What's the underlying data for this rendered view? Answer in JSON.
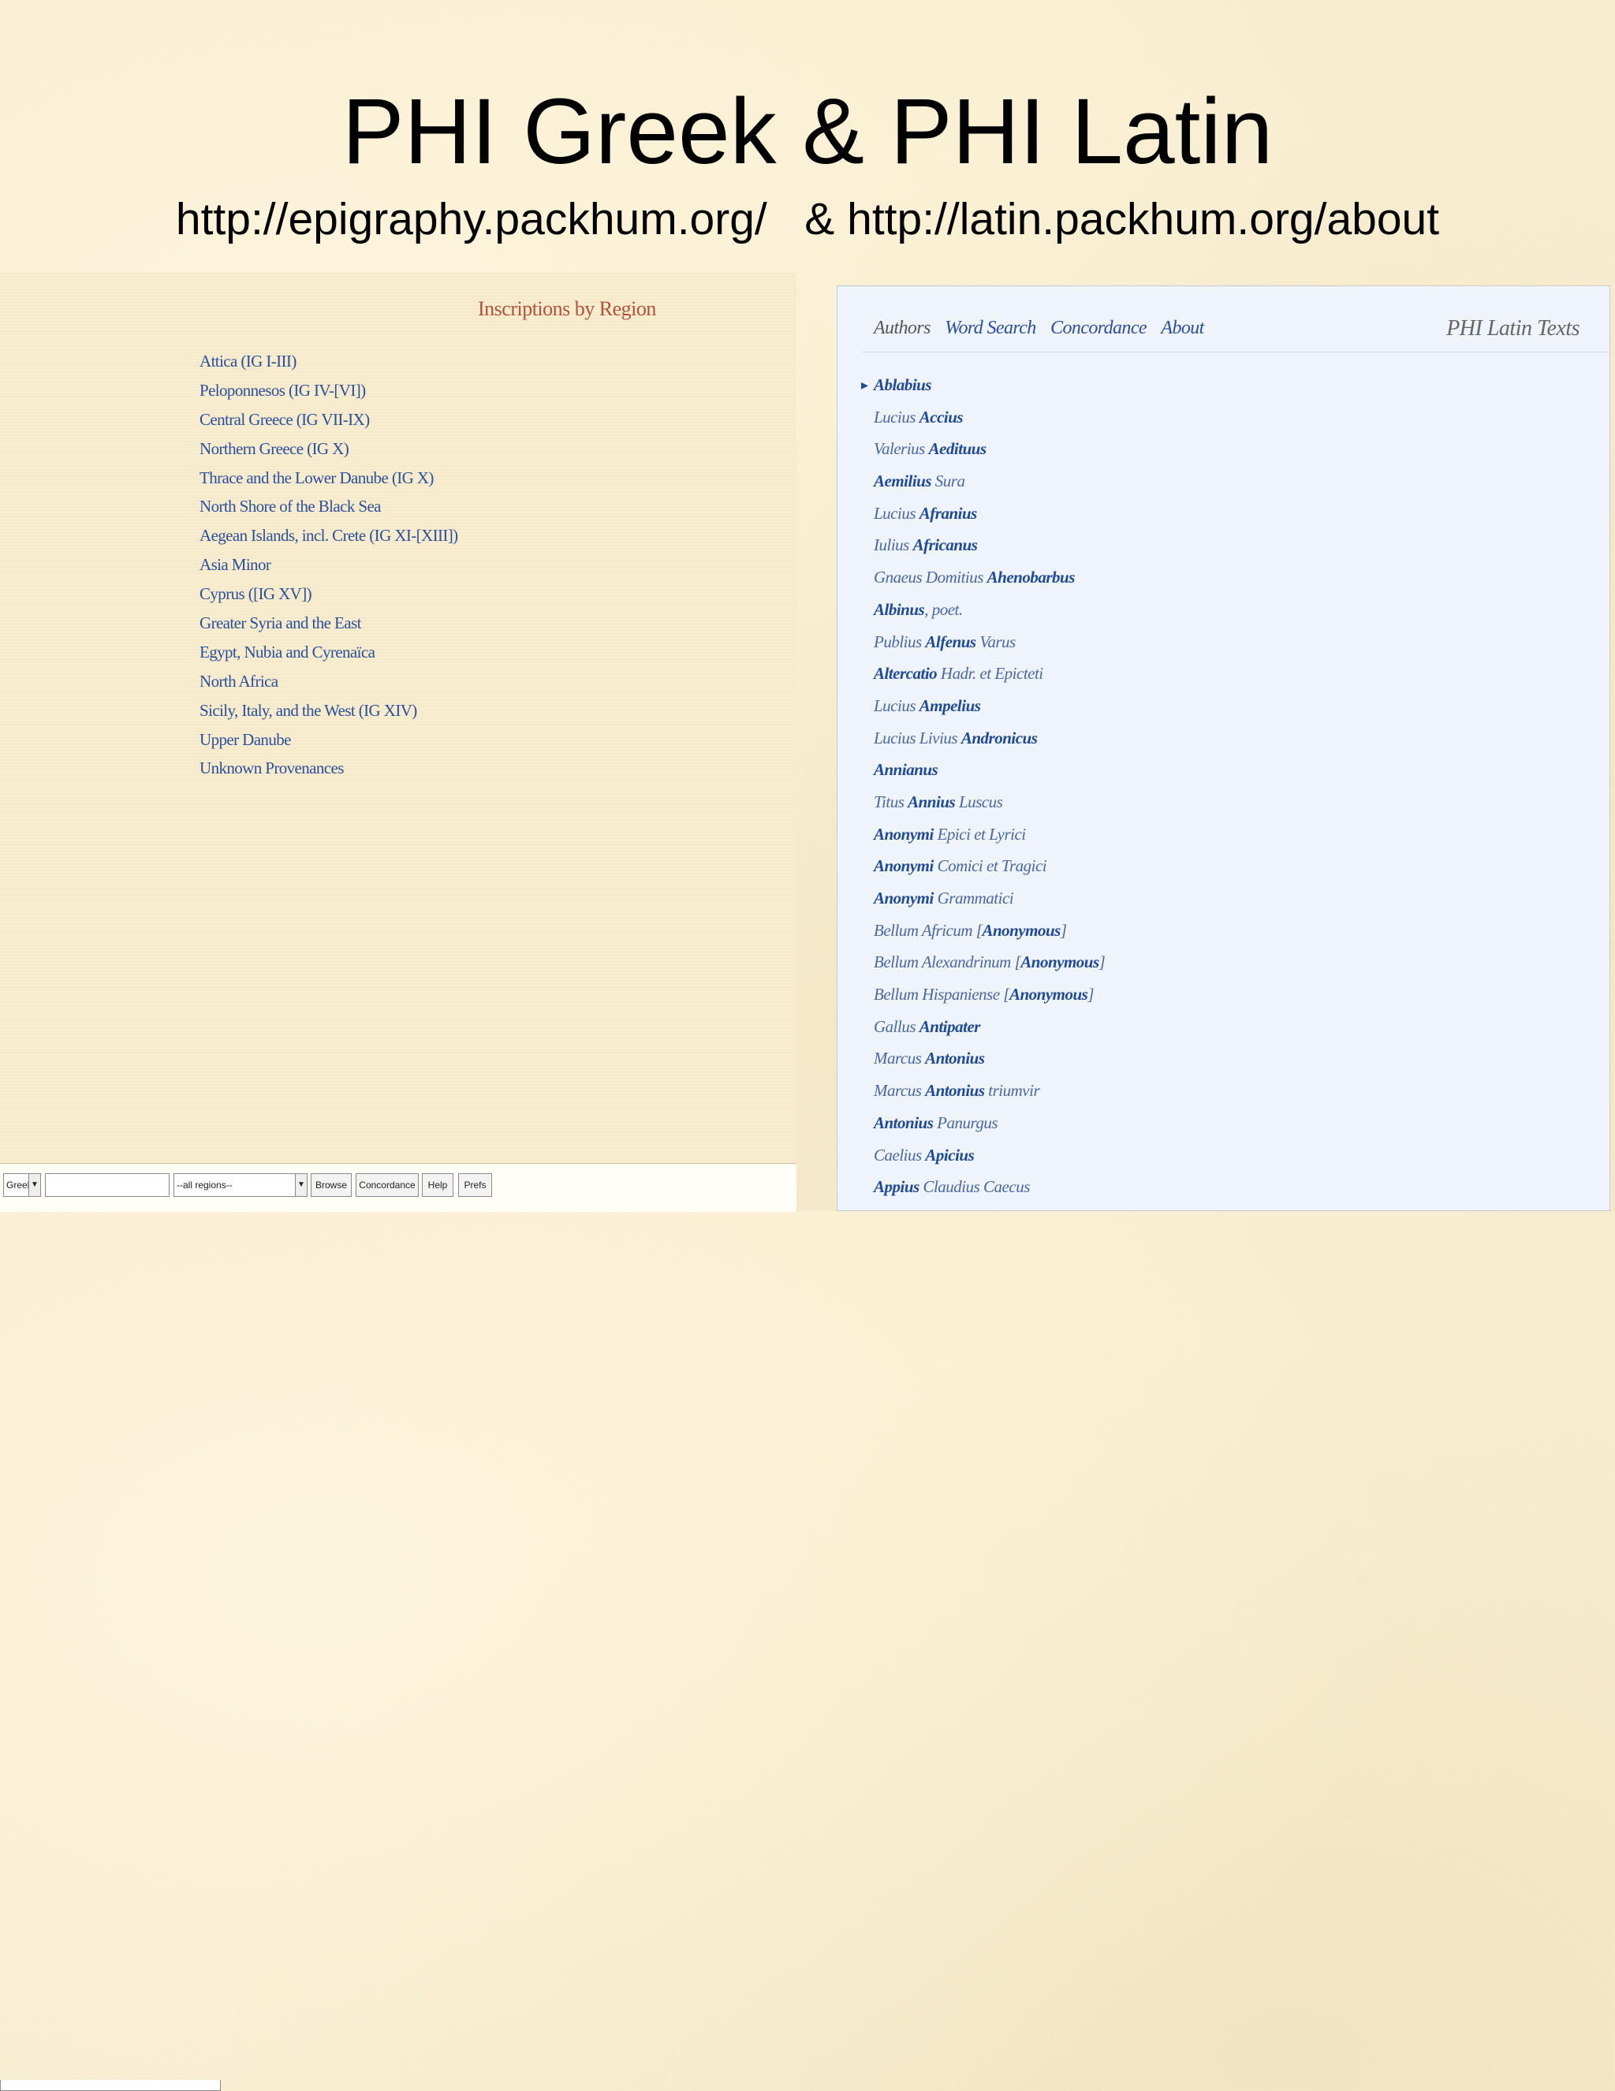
{
  "slide": {
    "title": "PHI Greek & PHI Latin",
    "subtitle": "http://epigraphy.packhum.org/   & http://latin.packhum.org/about"
  },
  "greek": {
    "heading": "Inscriptions by Region",
    "regions": [
      "Attica (IG I-III)",
      "Peloponnesos (IG IV-[VI])",
      "Central Greece (IG VII-IX)",
      "Northern Greece (IG X)",
      "Thrace and the Lower Danube (IG X)",
      "North Shore of the Black Sea",
      "Aegean Islands, incl. Crete (IG XI-[XIII])",
      "Asia Minor",
      "Cyprus ([IG XV])",
      "Greater Syria and the East",
      "Egypt, Nubia and Cyrenaïca",
      "North Africa",
      "Sicily, Italy, and the West (IG XIV)",
      "Upper Danube",
      "Unknown Provenances"
    ],
    "toolbar": {
      "language_select": "Greek",
      "search_value": "",
      "region_select": "--all regions--",
      "browse_label": "Browse",
      "concordance_label": "Concordance",
      "help_label": "Help",
      "prefs_label": "Prefs"
    }
  },
  "latin": {
    "nav": [
      "Authors",
      "Word Search",
      "Concordance",
      "About"
    ],
    "site_title": "PHI Latin Texts",
    "authors": [
      {
        "pre": "",
        "bold": "Ablabius",
        "post": ""
      },
      {
        "pre": "Lucius ",
        "bold": "Accius",
        "post": ""
      },
      {
        "pre": "Valerius ",
        "bold": "Aedituus",
        "post": ""
      },
      {
        "pre": "",
        "bold": "Aemilius",
        "post": " Sura"
      },
      {
        "pre": "Lucius ",
        "bold": "Afranius",
        "post": ""
      },
      {
        "pre": "Iulius ",
        "bold": "Africanus",
        "post": ""
      },
      {
        "pre": "Gnaeus Domitius ",
        "bold": "Ahenobarbus",
        "post": ""
      },
      {
        "pre": "",
        "bold": "Albinus",
        "post": ", poet."
      },
      {
        "pre": "Publius ",
        "bold": "Alfenus",
        "post": " Varus"
      },
      {
        "pre": "",
        "bold": "Altercatio",
        "post": " Hadr. et Epicteti"
      },
      {
        "pre": "Lucius ",
        "bold": "Ampelius",
        "post": ""
      },
      {
        "pre": "Lucius Livius ",
        "bold": "Andronicus",
        "post": ""
      },
      {
        "pre": "",
        "bold": "Annianus",
        "post": ""
      },
      {
        "pre": "Titus ",
        "bold": "Annius",
        "post": " Luscus"
      },
      {
        "pre": "",
        "bold": "Anonymi",
        "post": " Epici et Lyrici"
      },
      {
        "pre": "",
        "bold": "Anonymi",
        "post": " Comici et Tragici"
      },
      {
        "pre": "",
        "bold": "Anonymi",
        "post": " Grammatici"
      },
      {
        "pre": "Bellum Africum [",
        "bold": "Anonymous",
        "post": "]"
      },
      {
        "pre": "Bellum Alexandrinum [",
        "bold": "Anonymous",
        "post": "]"
      },
      {
        "pre": "Bellum Hispaniense [",
        "bold": "Anonymous",
        "post": "]"
      },
      {
        "pre": "Gallus ",
        "bold": "Antipater",
        "post": ""
      },
      {
        "pre": "Marcus ",
        "bold": "Antonius",
        "post": ""
      },
      {
        "pre": "Marcus ",
        "bold": "Antonius",
        "post": " triumvir"
      },
      {
        "pre": "",
        "bold": "Antonius",
        "post": " Panurgus"
      },
      {
        "pre": "Caelius ",
        "bold": "Apicius",
        "post": ""
      },
      {
        "pre": "",
        "bold": "Appius",
        "post": " Claudius Caecus"
      }
    ]
  }
}
